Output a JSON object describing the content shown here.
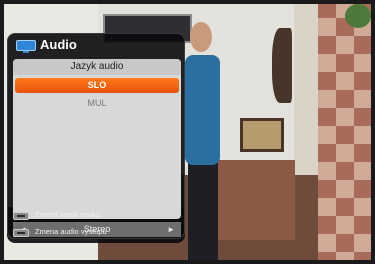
{
  "osd": {
    "title": "Audio",
    "list_header": "Jazyk audio",
    "items": [
      {
        "label": "SLO",
        "selected": true
      },
      {
        "label": "MUL",
        "selected": false
      }
    ],
    "output_mode": "Stereo",
    "hints": [
      {
        "label": "Zmeniť jazyk zvuku"
      },
      {
        "label": "Zmena audio výstupu"
      }
    ],
    "colors": {
      "accent": "#f26a12",
      "panel": "#0a0a0c",
      "list_bg": "#d8d8d8",
      "header_icon": "#2f86d6"
    },
    "icons": {
      "header": "tv-icon",
      "left": "arrow-left-icon",
      "right": "arrow-right-icon",
      "key": "remote-key-icon"
    }
  }
}
